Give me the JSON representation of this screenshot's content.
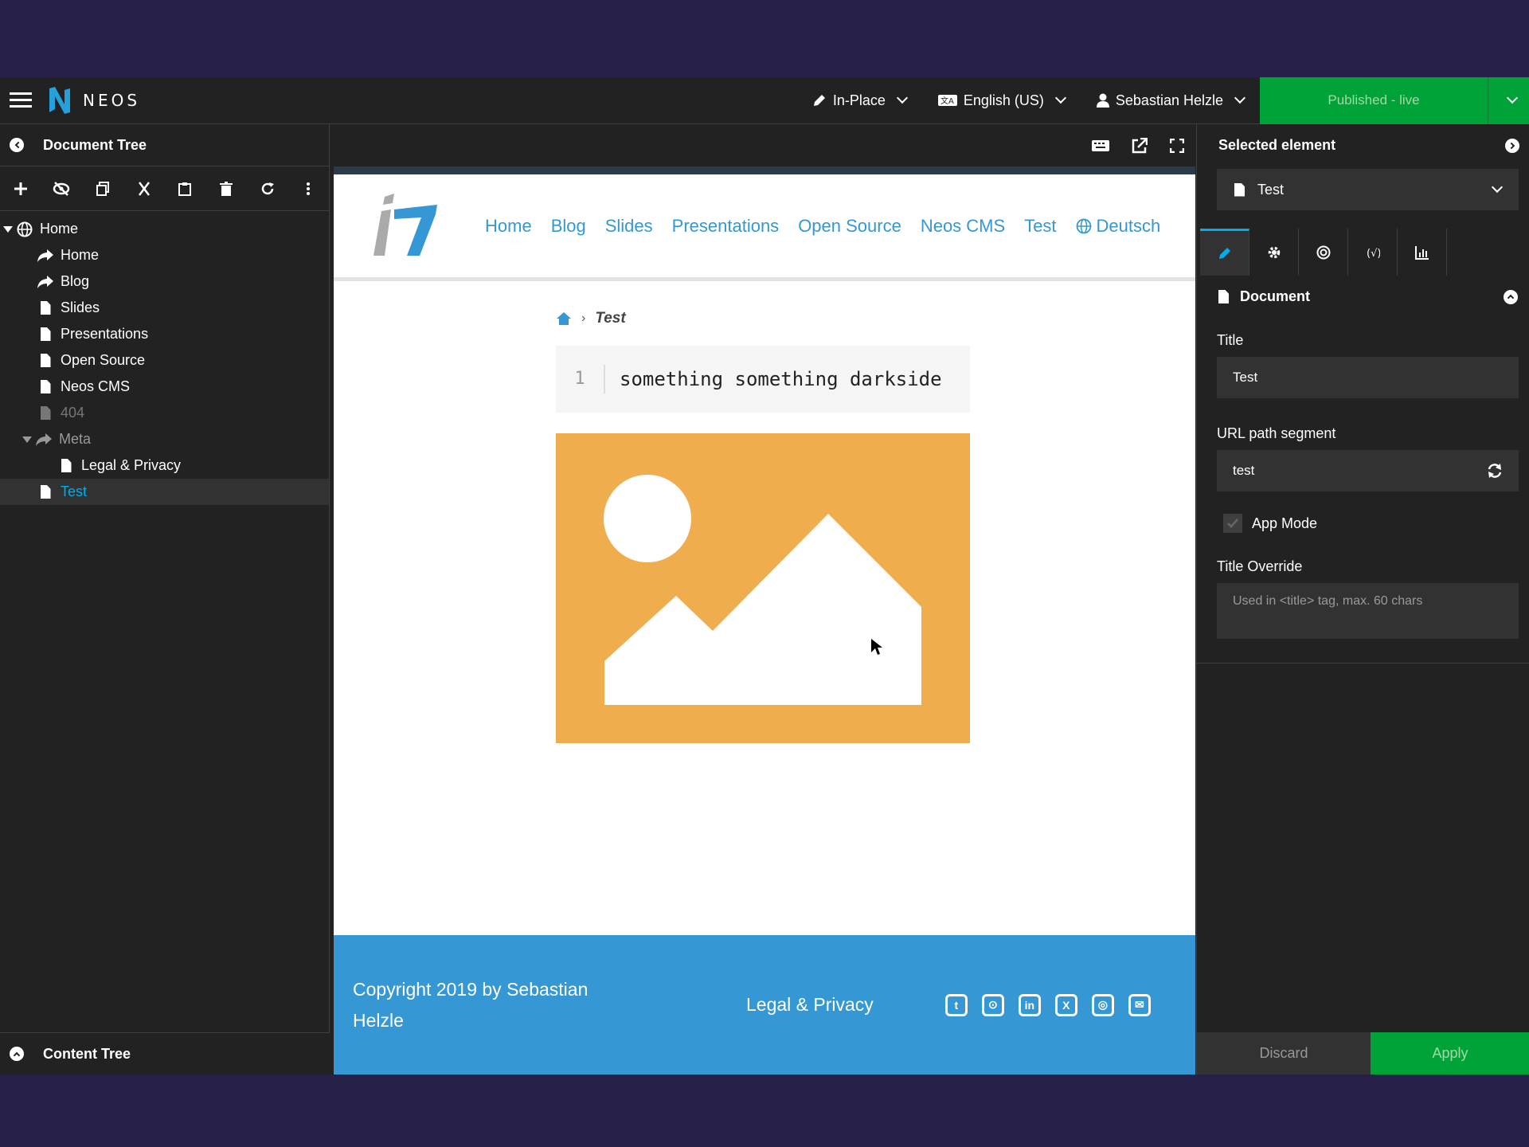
{
  "topbar": {
    "brand": "NEOS",
    "edit_mode": "In-Place",
    "language": "English (US)",
    "user": "Sebastian Helzle",
    "publish": "Published - live"
  },
  "left": {
    "title": "Document Tree",
    "tree": [
      {
        "label": "Home",
        "icon": "globe-icon"
      },
      {
        "label": "Home",
        "icon": "shortcut-icon"
      },
      {
        "label": "Blog",
        "icon": "shortcut-icon"
      },
      {
        "label": "Slides",
        "icon": "document-icon"
      },
      {
        "label": "Presentations",
        "icon": "document-icon"
      },
      {
        "label": "Open Source",
        "icon": "document-icon"
      },
      {
        "label": "Neos CMS",
        "icon": "document-icon"
      },
      {
        "label": "404",
        "icon": "document-icon"
      },
      {
        "label": "Meta",
        "icon": "shortcut-icon"
      },
      {
        "label": "Legal & Privacy",
        "icon": "document-icon"
      },
      {
        "label": "Test",
        "icon": "document-icon"
      }
    ],
    "content_tree": "Content Tree"
  },
  "site": {
    "nav": [
      "Home",
      "Blog",
      "Slides",
      "Presentations",
      "Open Source",
      "Neos CMS",
      "Test",
      "Deutsch"
    ],
    "breadcrumb_current": "Test",
    "code_line_number": "1",
    "code_text": "something something darkside",
    "footer_copyright": "Copyright 2019 by Sebastian Helzle",
    "footer_link": "Legal & Privacy",
    "social_icons": [
      "twitter-icon",
      "github-icon",
      "linkedin-icon",
      "xing-icon",
      "instagram-icon",
      "mail-icon"
    ],
    "colors": {
      "link": "#3597d3",
      "footer": "#3597d3",
      "placeholder": "#f0ad4e"
    }
  },
  "right": {
    "title": "Selected element",
    "selected": "Test",
    "section": "Document",
    "title_label": "Title",
    "title_value": "Test",
    "url_label": "URL path segment",
    "url_value": "test",
    "app_mode_label": "App Mode",
    "title_override_label": "Title Override",
    "title_override_placeholder": "Used in <title> tag, max. 60 chars",
    "discard": "Discard",
    "apply": "Apply"
  },
  "colors": {
    "accent": "#00adee",
    "publish_green": "#00a338",
    "frame_bg": "#272149"
  }
}
